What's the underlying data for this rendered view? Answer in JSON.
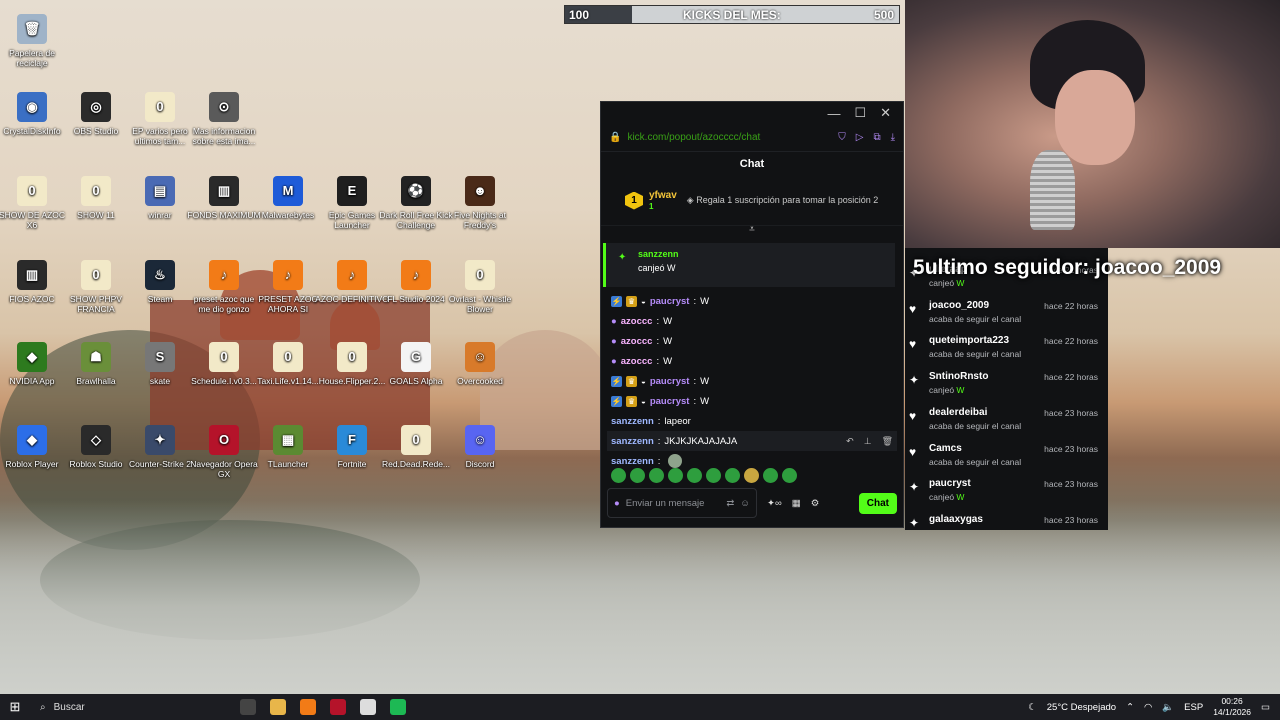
{
  "desktop": {
    "icons": [
      {
        "label": "Papelera de reciclaje",
        "icon": "recycle-bin-icon",
        "color": "#9fb3c8",
        "glyph": "🗑"
      },
      {
        "label": "CrystalDiskInfo",
        "icon": "crystaldisk-icon",
        "color": "#3a6fc4",
        "glyph": "◉"
      },
      {
        "label": "OBS Studio",
        "icon": "obs-icon",
        "color": "#2b2b2b",
        "glyph": "◎"
      },
      {
        "label": "EP varios pero ultimos tam...",
        "icon": "document-icon",
        "color": "#f2e9c8",
        "glyph": "0"
      },
      {
        "label": "Mas informacion sobre esta ima...",
        "icon": "info-icon",
        "color": "#5a5a5a",
        "glyph": "⊙"
      },
      {
        "label": "SHOW DE AZOC X6",
        "icon": "document-icon",
        "color": "#f2e9c8",
        "glyph": "0"
      },
      {
        "label": "SHOW 11",
        "icon": "document-icon",
        "color": "#f2e9c8",
        "glyph": "0"
      },
      {
        "label": "winrar",
        "icon": "winrar-icon",
        "color": "#4a6ab4",
        "glyph": "▤"
      },
      {
        "label": "FONDS MAXIMUM",
        "icon": "archive-icon",
        "color": "#2a2a2a",
        "glyph": "▥"
      },
      {
        "label": "Malwarebytes",
        "icon": "malwarebytes-icon",
        "color": "#1e5bd8",
        "glyph": "M"
      },
      {
        "label": "Epic Games Launcher",
        "icon": "epic-games-icon",
        "color": "#1f1f1f",
        "glyph": "E"
      },
      {
        "label": "Dark Roll Free Kick Challenge",
        "icon": "game-ball-icon",
        "color": "#222",
        "glyph": "⚽"
      },
      {
        "label": "Five Nights at Freddy's",
        "icon": "fnaf-icon",
        "color": "#4a2a18",
        "glyph": "☻"
      },
      {
        "label": "FIOS AZOC",
        "icon": "archive-icon",
        "color": "#2a2a2a",
        "glyph": "▥"
      },
      {
        "label": "SHOW PHPV FRANCIA",
        "icon": "document-icon",
        "color": "#f2e9c8",
        "glyph": "0"
      },
      {
        "label": "Steam",
        "icon": "steam-icon",
        "color": "#1b2838",
        "glyph": "♨"
      },
      {
        "label": "preset azoc que me dio gonzo",
        "icon": "fl-studio-icon",
        "color": "#f27b17",
        "glyph": "♪"
      },
      {
        "label": "PRESET AZOC AHORA SI",
        "icon": "fl-studio-icon",
        "color": "#f27b17",
        "glyph": "♪"
      },
      {
        "label": "AZOC DEFINITIVO",
        "icon": "fl-studio-icon",
        "color": "#f27b17",
        "glyph": "♪"
      },
      {
        "label": "FL Studio 2024",
        "icon": "fl-studio-icon",
        "color": "#f27b17",
        "glyph": "♪"
      },
      {
        "label": "Ovrlast - Whistle Blower",
        "icon": "document-icon",
        "color": "#f2e9c8",
        "glyph": "0"
      },
      {
        "label": "NVIDIA App",
        "icon": "nvidia-icon",
        "color": "#2d7a1e",
        "glyph": "◆"
      },
      {
        "label": "Brawlhalla",
        "icon": "brawlhalla-icon",
        "color": "#6a8f3a",
        "glyph": "☗"
      },
      {
        "label": "skate",
        "icon": "skate-icon",
        "color": "#777",
        "glyph": "S"
      },
      {
        "label": "Schedule.I.v0.3...",
        "icon": "document-icon",
        "color": "#f2e9c8",
        "glyph": "0"
      },
      {
        "label": "Taxi.Life.v1.14...",
        "icon": "document-icon",
        "color": "#f2e9c8",
        "glyph": "0"
      },
      {
        "label": "House.Flipper.2...",
        "icon": "document-icon",
        "color": "#f2e9c8",
        "glyph": "0"
      },
      {
        "label": "GOALS Alpha",
        "icon": "goals-icon",
        "color": "#f4f4f4",
        "glyph": "G"
      },
      {
        "label": "Overcooked",
        "icon": "overcooked-icon",
        "color": "#d87a2a",
        "glyph": "☺"
      },
      {
        "label": "Roblox Player",
        "icon": "roblox-icon",
        "color": "#2c6ee8",
        "glyph": "◆"
      },
      {
        "label": "Roblox Studio",
        "icon": "roblox-studio-icon",
        "color": "#2a2a2a",
        "glyph": "◇"
      },
      {
        "label": "Counter-Strike 2",
        "icon": "cs2-icon",
        "color": "#3a4a6a",
        "glyph": "✦"
      },
      {
        "label": "Navegador Opera GX",
        "icon": "opera-gx-icon",
        "color": "#b5132a",
        "glyph": "O"
      },
      {
        "label": "TLauncher",
        "icon": "tlauncher-icon",
        "color": "#5b8a32",
        "glyph": "▦"
      },
      {
        "label": "Fortnite",
        "icon": "fortnite-icon",
        "color": "#2a8ad8",
        "glyph": "F"
      },
      {
        "label": "Red.Dead.Rede...",
        "icon": "document-icon",
        "color": "#f2e9c8",
        "glyph": "0"
      },
      {
        "label": "Discord",
        "icon": "discord-icon",
        "color": "#5865f2",
        "glyph": "☺"
      }
    ]
  },
  "kicks_bar": {
    "left": "100",
    "label": "KICKS DEL MES:",
    "right": "500",
    "progress": 0.2
  },
  "chat_window": {
    "url": "kick.com/popout/azocccc/chat",
    "header": "Chat",
    "pinned": {
      "badge": "1",
      "user": "yfwav",
      "count": "1",
      "message": "Regala 1 suscripción para tomar la posición 2"
    },
    "redeem": {
      "user": "sanzzenn",
      "text": "canjeó W"
    },
    "messages": [
      {
        "user": "paucryst",
        "text": "W",
        "cls": "u-purple",
        "badges": true
      },
      {
        "user": "azoccc",
        "text": "W",
        "cls": "u-pink",
        "badges": false,
        "mic": true
      },
      {
        "user": "azoccc",
        "text": "W",
        "cls": "u-pink",
        "badges": false,
        "mic": true
      },
      {
        "user": "azoccc",
        "text": "W",
        "cls": "u-pink",
        "badges": false,
        "mic": true
      },
      {
        "user": "paucryst",
        "text": "W",
        "cls": "u-purple",
        "badges": true
      },
      {
        "user": "paucryst",
        "text": "W",
        "cls": "u-purple",
        "badges": true
      },
      {
        "user": "sanzzenn",
        "text": "lapeor",
        "cls": "u-blue",
        "badges": false
      },
      {
        "user": "sanzzenn",
        "text": "JKJKJKAJAJAJA",
        "cls": "u-blue",
        "badges": false,
        "hover": true
      },
      {
        "user": "sanzzenn",
        "text": "",
        "cls": "u-blue",
        "badges": false,
        "emote": true
      }
    ],
    "placeholder": "Enviar un mensaje",
    "send_label": "Chat"
  },
  "feed": {
    "banner_num": "5",
    "banner": "ultimo seguidor: joacoo_2009",
    "items": [
      {
        "user": "ulietaap",
        "desc": "canjeó ",
        "w": "W",
        "time": "hace 21 horas",
        "icon": "redeem-icon",
        "glyph": "✦"
      },
      {
        "user": "joacoo_2009",
        "desc": "acaba de seguir el canal",
        "w": "",
        "time": "hace 22 horas",
        "icon": "heart-icon",
        "glyph": "♥"
      },
      {
        "user": "queteimporta223",
        "desc": "acaba de seguir el canal",
        "w": "",
        "time": "hace 22 horas",
        "icon": "heart-icon",
        "glyph": "♥"
      },
      {
        "user": "SntinoRnsto",
        "desc": "canjeó ",
        "w": "W",
        "time": "hace 22 horas",
        "icon": "redeem-icon",
        "glyph": "✦"
      },
      {
        "user": "dealerdeibai",
        "desc": "acaba de seguir el canal",
        "w": "",
        "time": "hace 23 horas",
        "icon": "heart-icon",
        "glyph": "♥"
      },
      {
        "user": "Camcs",
        "desc": "acaba de seguir el canal",
        "w": "",
        "time": "hace 23 horas",
        "icon": "heart-icon",
        "glyph": "♥"
      },
      {
        "user": "paucryst",
        "desc": "canjeó ",
        "w": "W",
        "time": "hace 23 horas",
        "icon": "redeem-icon",
        "glyph": "✦"
      },
      {
        "user": "galaaxygas",
        "desc": "",
        "w": "",
        "time": "hace 23 horas",
        "icon": "redeem-icon",
        "glyph": "✦"
      }
    ]
  },
  "taskbar": {
    "search": "Buscar",
    "weather": "25°C  Despejado",
    "lang": "ESP",
    "time": "00:26",
    "date": "14/1/2026",
    "apps": [
      {
        "icon": "task-view-icon",
        "color": "#444"
      },
      {
        "icon": "file-explorer-icon",
        "color": "#e8b64a"
      },
      {
        "icon": "fl-studio-icon",
        "color": "#f27b17"
      },
      {
        "icon": "opera-gx-icon",
        "color": "#b5132a"
      },
      {
        "icon": "obs-icon",
        "color": "#ddd"
      },
      {
        "icon": "spotify-icon",
        "color": "#1db954"
      }
    ]
  }
}
